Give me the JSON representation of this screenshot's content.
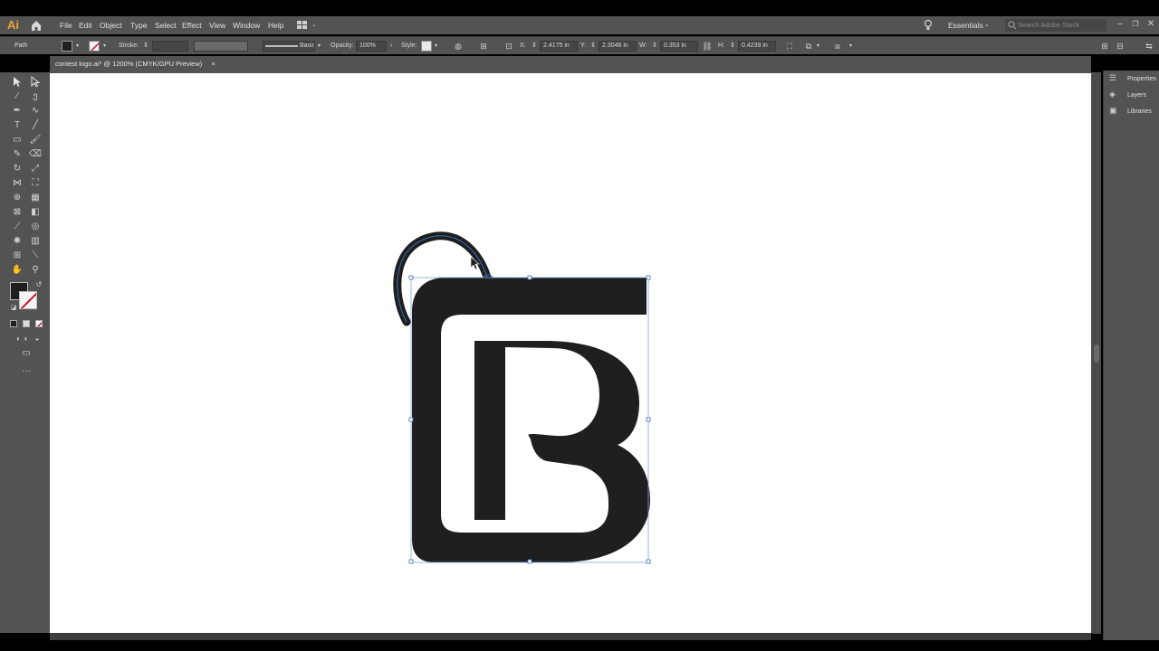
{
  "app": {
    "logo": "Ai"
  },
  "menu": [
    "File",
    "Edit",
    "Object",
    "Type",
    "Select",
    "Effect",
    "View",
    "Window",
    "Help"
  ],
  "workspace_switcher": "Essentials",
  "search": {
    "placeholder": "Search Adobe Stock"
  },
  "controlbar": {
    "selection_type": "Path",
    "stroke_label": "Stroke:",
    "brush": "Basic",
    "opacity_label": "Opacity:",
    "opacity_value": "100%",
    "style_label": "Style:",
    "x_label": "X:",
    "x_value": "2.4175 in",
    "y_label": "Y:",
    "y_value": "2.3046 in",
    "w_label": "W:",
    "w_value": "0.353 in",
    "h_label": "H:",
    "h_value": "0.4239 in"
  },
  "document_tab": {
    "title": "contest logo.ai* @ 1200% (CMYK/GPU Preview)",
    "close": "×"
  },
  "right_panel": [
    "Properties",
    "Layers",
    "Libraries"
  ],
  "colors": {
    "ui_bg": "#535353",
    "artboard": "#ffffff",
    "artwork": "#1f1f1f",
    "selection": "#3d6fb6",
    "app_icon": "#e8a33a"
  },
  "icons": [
    "home-icon",
    "lightbulb-icon",
    "search-icon",
    "selection-tool-icon",
    "direct-selection-tool-icon",
    "pen-tool-icon",
    "type-tool-icon",
    "hand-tool-icon",
    "zoom-tool-icon",
    "properties-icon",
    "layers-icon",
    "libraries-icon"
  ]
}
